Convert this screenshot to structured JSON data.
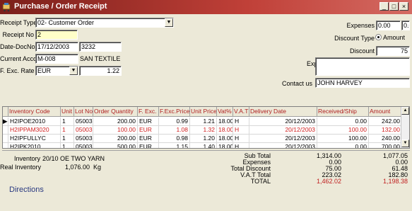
{
  "window": {
    "title": "Purchase / Order Receipt",
    "buttons": [
      "_",
      "□",
      "×"
    ]
  },
  "header": {
    "receipt_type_label": "Receipt Type",
    "receipt_type_value": "02- Customer Order",
    "receipt_no_label": "Receipt No",
    "receipt_no_value": "2",
    "date_docno_label": "Date-DocNo",
    "date_value": "17/12/2003",
    "docno_value": "3232",
    "current_account_label": "Current Account",
    "current_account_code": "M-008",
    "current_account_name": "SAN TEXTILE",
    "fexc_rate_label": "F. Exc. Rate",
    "fexc_currency": "EUR",
    "fexc_rate_value": "1.22",
    "expenses_label": "Expenses",
    "expenses_value_1": "0.00",
    "expenses_value_2": "0.00",
    "discount_type_label": "Discount Type",
    "discount_type_amount": "Amount",
    "discount_type_percent": "Percent",
    "discount_type_selected": "Amount",
    "discount_label": "Discount",
    "discount_value": "75",
    "explanation_label": "Explanation",
    "explanation_value": "",
    "contact_label": "Contact us",
    "contact_value": "JOHN HARVEY"
  },
  "table": {
    "columns": [
      "Inventory Code",
      "Unit",
      "Lot No",
      "Order Quantity",
      "F. Exc.",
      "F.Exc.Price",
      "Unit Price",
      "Vat%",
      "V.A.T",
      "Delivery Date",
      "Received/Ship",
      "Amount"
    ],
    "rows": [
      {
        "selected": true,
        "red": false,
        "cells": [
          "H2IPOE2010",
          "1",
          "05003",
          "200.00",
          "EUR",
          "0.99",
          "1.21",
          "18.00",
          "H",
          "20/12/2003",
          "0.00",
          "242.00"
        ]
      },
      {
        "selected": false,
        "red": true,
        "cells": [
          "H2IPPAM3020",
          "1",
          "05003",
          "100.00",
          "EUR",
          "1.08",
          "1.32",
          "18.00",
          "H",
          "20/12/2003",
          "100.00",
          "132.00"
        ]
      },
      {
        "selected": false,
        "red": false,
        "cells": [
          "H2IPFULLYC",
          "1",
          "05003",
          "200.00",
          "EUR",
          "0.98",
          "1.20",
          "18.00",
          "H",
          "20/12/2003",
          "100.00",
          "240.00"
        ]
      },
      {
        "selected": false,
        "red": false,
        "cells": [
          "H2IPK2010",
          "1",
          "05003",
          "500.00",
          "EUR",
          "1.15",
          "1.40",
          "18.00",
          "H",
          "20/12/2003",
          "0.00",
          "700.00"
        ]
      }
    ]
  },
  "footer": {
    "inventory_label": "Inventory",
    "inventory_value": "20/10 OE TWO YARN",
    "real_inventory_label": "Real Inventory",
    "real_inventory_value": "1,076.00",
    "real_inventory_unit": "Kg",
    "directions": "Directions",
    "totals": [
      {
        "label": "Sub Total",
        "v1": "1,314.00",
        "v2": "1,077.05",
        "red": false
      },
      {
        "label": "Expenses",
        "v1": "0.00",
        "v2": "0.00",
        "red": false
      },
      {
        "label": "Total Discount",
        "v1": "75.00",
        "v2": "61.48",
        "red": false
      },
      {
        "label": "V.A.T Total",
        "v1": "223.02",
        "v2": "182.80",
        "red": false
      },
      {
        "label": "TOTAL",
        "v1": "1,462.02",
        "v2": "1,198.38",
        "red": true
      }
    ]
  },
  "colors": {
    "title_bar": "#a83028",
    "header_text": "#b02020",
    "red_row": "#d02020",
    "directions": "#2a3a80"
  }
}
